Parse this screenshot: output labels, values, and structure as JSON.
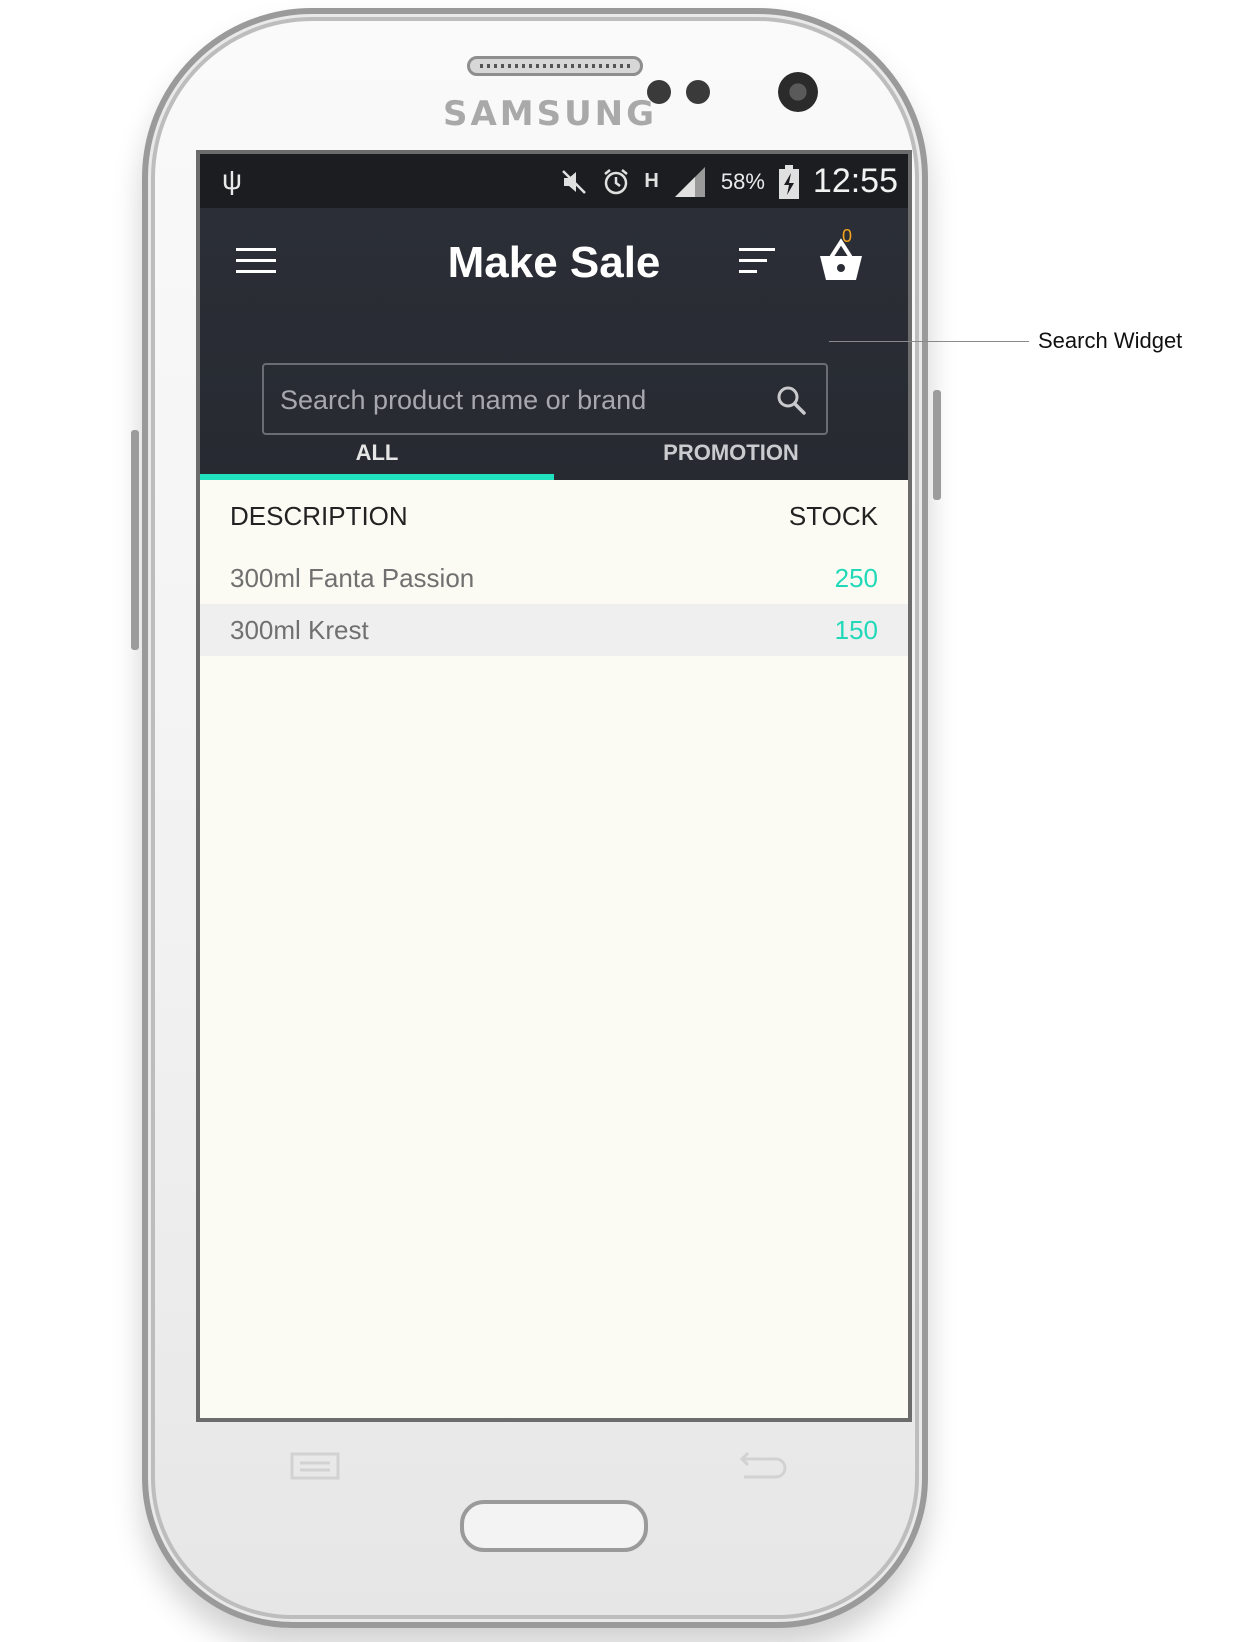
{
  "device": {
    "brand": "SAMSUNG"
  },
  "status_bar": {
    "battery": "58%",
    "time": "12:55",
    "network": "H"
  },
  "app_bar": {
    "title": "Make Sale",
    "cart_count": "0"
  },
  "search": {
    "placeholder": "Search product name or brand",
    "value": ""
  },
  "tabs": [
    {
      "label": "ALL",
      "active": true
    },
    {
      "label": "PROMOTION",
      "active": false
    }
  ],
  "list": {
    "columns": {
      "description": "DESCRIPTION",
      "stock": "STOCK"
    },
    "rows": [
      {
        "description": "300ml Fanta Passion",
        "stock": "250"
      },
      {
        "description": "300ml Krest",
        "stock": "150"
      }
    ]
  },
  "annotation": {
    "label": "Search Widget"
  },
  "colors": {
    "accent": "#21e2be",
    "appbar": "#2b2e36",
    "badge": "#f4a51c",
    "background": "#fbfbf3"
  }
}
